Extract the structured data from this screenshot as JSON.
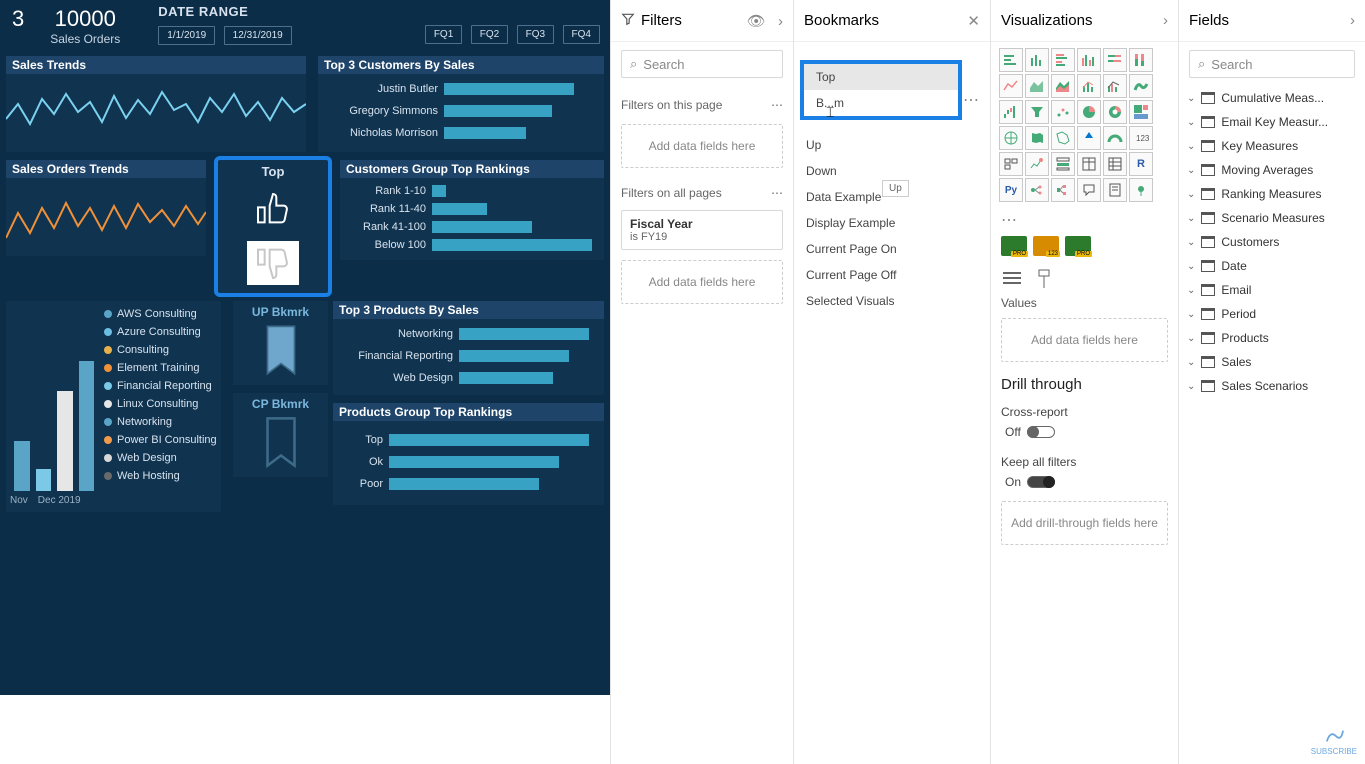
{
  "canvas": {
    "kpi1_val": "3",
    "kpi2_val": "10000",
    "kpi2_lbl": "Sales Orders",
    "date_range_lbl": "DATE RANGE",
    "date_start": "1/1/2019",
    "date_end": "12/31/2019",
    "fq": [
      "FQ1",
      "FQ2",
      "FQ3",
      "FQ4"
    ],
    "cards": {
      "sales_trends": "Sales Trends",
      "top3_cust": "Top 3 Customers By Sales",
      "sales_orders_trends": "Sales Orders Trends",
      "cust_rank": "Customers Group Top Rankings",
      "top3_prod": "Top 3 Products By Sales",
      "prod_rank": "Products Group Top Rankings"
    },
    "bookmark_btn": {
      "top": "Top",
      "up": "UP Bkmrk",
      "cp": "CP Bkmrk"
    },
    "legend_items": [
      "AWS Consulting",
      "Azure Consulting",
      "Consulting",
      "Element Training",
      "Financial Reporting",
      "Linux Consulting",
      "Networking",
      "Power BI Consulting",
      "Web Design",
      "Web Hosting"
    ],
    "legend_colors": [
      "#5aa5c7",
      "#6cbde2",
      "#e8b04a",
      "#f0913a",
      "#7bc9e6",
      "#e6e6e6",
      "#5aa5c7",
      "#f09a4a",
      "#d7d7d7",
      "#6a6a6a"
    ],
    "xaxis": {
      "nov": "Nov",
      "dec": "Dec 2019"
    }
  },
  "chart_data": [
    {
      "type": "bar",
      "title": "Top 3 Customers By Sales",
      "orientation": "h",
      "categories": [
        "Justin Butler",
        "Gregory Simmons",
        "Nicholas Morrison"
      ],
      "values": [
        100,
        82,
        63
      ],
      "xlim": [
        0,
        100
      ]
    },
    {
      "type": "bar",
      "title": "Customers Group Top Rankings",
      "orientation": "h",
      "categories": [
        "Rank 1-10",
        "Rank 11-40",
        "Rank 41-100",
        "Below 100"
      ],
      "values": [
        8,
        35,
        62,
        100
      ],
      "xlim": [
        0,
        100
      ]
    },
    {
      "type": "bar",
      "title": "Top 3 Products By Sales",
      "orientation": "h",
      "categories": [
        "Networking",
        "Financial Reporting",
        "Web Design"
      ],
      "values": [
        100,
        85,
        72
      ],
      "xlim": [
        0,
        100
      ]
    },
    {
      "type": "bar",
      "title": "Products Group Top Rankings",
      "orientation": "h",
      "categories": [
        "Top",
        "Ok",
        "Poor"
      ],
      "values": [
        100,
        85,
        75
      ],
      "xlim": [
        0,
        100
      ]
    },
    {
      "type": "line",
      "title": "Sales Trends",
      "series": [
        {
          "name": "Sales",
          "color": "#7bd2f0"
        }
      ],
      "x_range": [
        "Jan 2019",
        "Dec 2019"
      ]
    },
    {
      "type": "line",
      "title": "Sales Orders Trends",
      "series": [
        {
          "name": "Orders",
          "color": "#f0913a"
        }
      ],
      "x_range": [
        "Jan 2019",
        "Dec 2019"
      ]
    }
  ],
  "filters": {
    "title": "Filters",
    "search_ph": "Search",
    "sect1": "Filters on this page",
    "well": "Add data fields here",
    "sect2": "Filters on all pages",
    "fy_name": "Fiscal Year",
    "fy_val": "is FY19"
  },
  "bookmarks": {
    "title": "Bookmarks",
    "popup_items": [
      "Top",
      "B...m"
    ],
    "items": [
      "Up",
      "Down",
      "Data Example",
      "Display Example",
      "Current Page On",
      "Current Page Off",
      "Selected Visuals"
    ],
    "tooltip": "Up"
  },
  "viz": {
    "title": "Visualizations",
    "values_lbl": "Values",
    "well": "Add data fields here",
    "drill_title": "Drill through",
    "cross_report": "Cross-report",
    "off": "Off",
    "keep_filters": "Keep all filters",
    "on": "On",
    "drill_well": "Add drill-through fields here"
  },
  "fields": {
    "title": "Fields",
    "search_ph": "Search",
    "tables": [
      "Cumulative Meas...",
      "Email Key Measur...",
      "Key Measures",
      "Moving Averages",
      "Ranking Measures",
      "Scenario Measures",
      "Customers",
      "Date",
      "Email",
      "Period",
      "Products",
      "Sales",
      "Sales Scenarios"
    ]
  },
  "subscribe": "SUBSCRIBE"
}
